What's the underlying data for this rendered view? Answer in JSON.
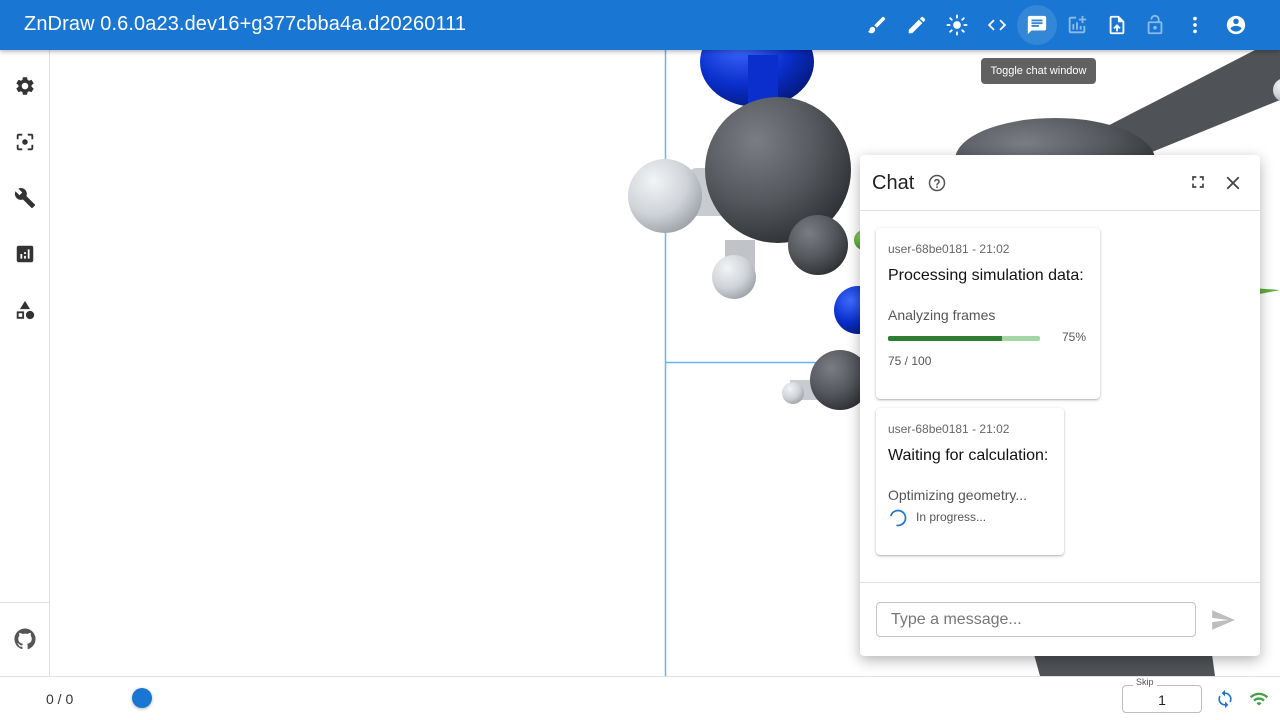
{
  "app": {
    "title": "ZnDraw 0.6.0a23.dev16+g377cbba4a.d20260111"
  },
  "toolbar": {
    "buttons": [
      {
        "icon": "paintbrush-icon"
      },
      {
        "icon": "pencil-icon"
      },
      {
        "icon": "brightness-icon"
      },
      {
        "icon": "code-icon"
      },
      {
        "icon": "chat-icon"
      },
      {
        "icon": "add-chart-icon"
      },
      {
        "icon": "upload-file-icon"
      },
      {
        "icon": "lock-open-icon"
      },
      {
        "icon": "more-vert-icon"
      },
      {
        "icon": "account-circle-icon"
      }
    ],
    "tooltip": "Toggle chat window"
  },
  "sidebar": {
    "items": [
      {
        "icon": "gear-icon"
      },
      {
        "icon": "center-focus-icon"
      },
      {
        "icon": "wrench-icon"
      },
      {
        "icon": "analytics-icon"
      },
      {
        "icon": "shapes-icon"
      },
      {
        "icon": "github-icon"
      }
    ]
  },
  "bottom": {
    "frame_counter": "0 / 0",
    "skip_label": "Skip",
    "skip_value": "1"
  },
  "chat": {
    "title": "Chat",
    "messages": [
      {
        "meta": "user-68be0181 - 21:02",
        "title": "Processing simulation data:",
        "subtitle": "Analyzing frames",
        "progress_percent": 75,
        "progress_label": "75%",
        "progress_count": "75 / 100"
      },
      {
        "meta": "user-68be0181 - 21:02",
        "title": "Waiting for calculation:",
        "subtitle": "Optimizing geometry...",
        "status": "In progress..."
      }
    ],
    "input_placeholder": "Type a message..."
  },
  "colors": {
    "primary": "#1976d2",
    "progress": "#2e7d32",
    "progress_track": "#a5d6a7",
    "atom_carbon": "#4f5256",
    "atom_nitrogen": "#0a2fcc",
    "atom_hydrogen": "#cfd3d8",
    "atom_chlorine": "#5fae3a"
  }
}
